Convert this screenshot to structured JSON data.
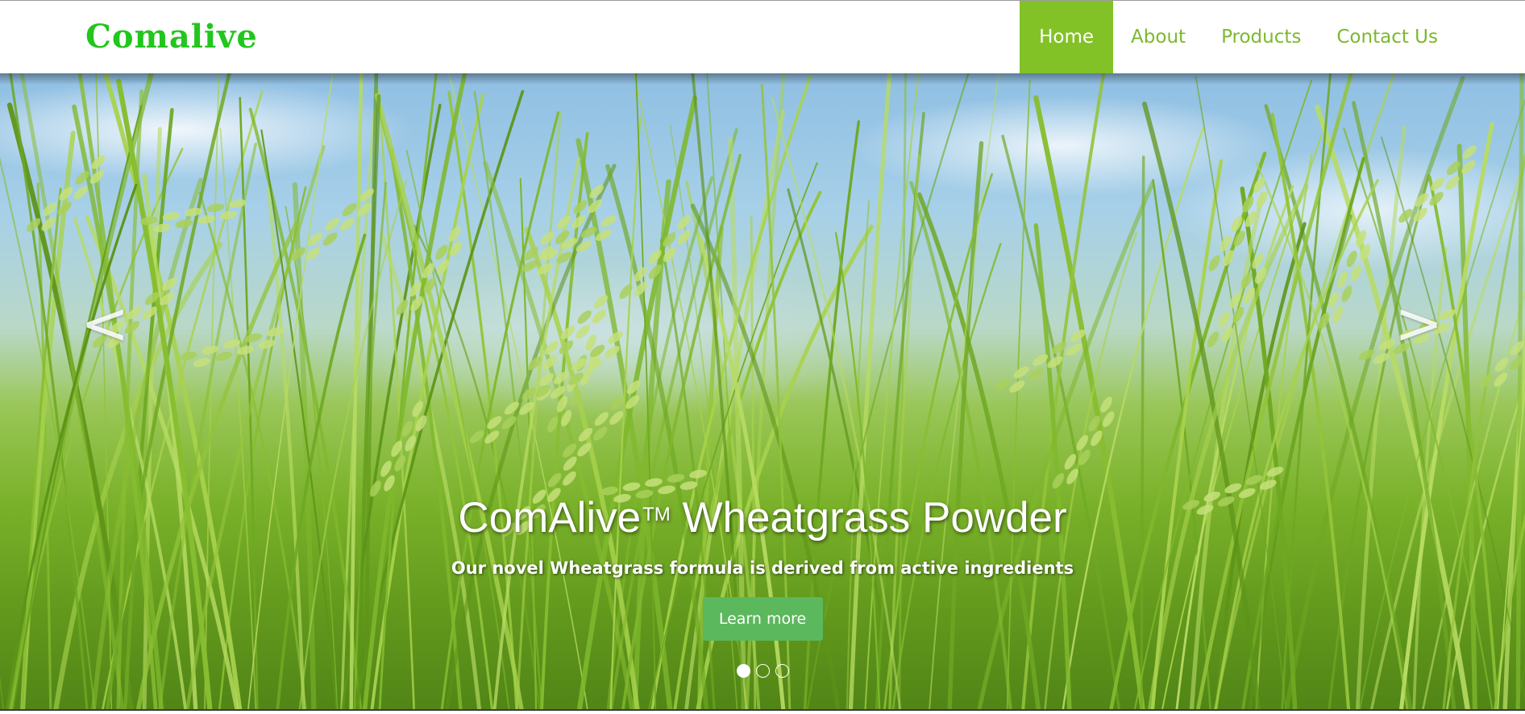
{
  "header": {
    "logo": "Comalive",
    "nav": [
      {
        "label": "Home",
        "active": true
      },
      {
        "label": "About",
        "active": false
      },
      {
        "label": "Products",
        "active": false
      },
      {
        "label": "Contact Us",
        "active": false
      }
    ]
  },
  "hero": {
    "prev_label": "<",
    "next_label": ">",
    "title": "ComAlive",
    "title_mark": "TM",
    "title_rest": " Wheatgrass Powder",
    "subtitle": "Our novel Wheatgrass formula is derived from active ingredients",
    "cta_label": "Learn more",
    "slides_count": 3,
    "active_slide": 1
  },
  "colors": {
    "logo": "#22c61d",
    "nav_text": "#7cb82f",
    "nav_active_bg": "#82c226",
    "cta_bg": "#5cb85c"
  }
}
